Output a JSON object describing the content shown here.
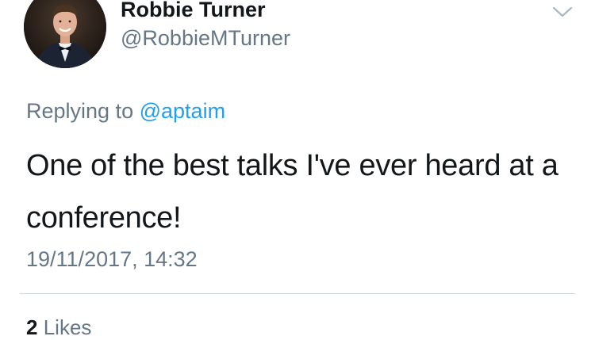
{
  "tweet": {
    "author": {
      "name": "Robbie Turner",
      "handle": "@RobbieMTurner",
      "avatar_icon": "avatar-photo"
    },
    "replying_to": {
      "prefix": "Replying to",
      "mention": "@aptaim"
    },
    "text": "One of the best talks I've ever heard at a conference!",
    "timestamp": "19/11/2017, 14:32",
    "likes": {
      "count": "2",
      "label": "Likes"
    },
    "menu_icon": "chevron-down-icon"
  },
  "colors": {
    "text_primary": "#14171a",
    "text_secondary": "#657786",
    "link": "#1da1f2",
    "divider": "#d0d8de",
    "chevron": "#aab8c2"
  }
}
